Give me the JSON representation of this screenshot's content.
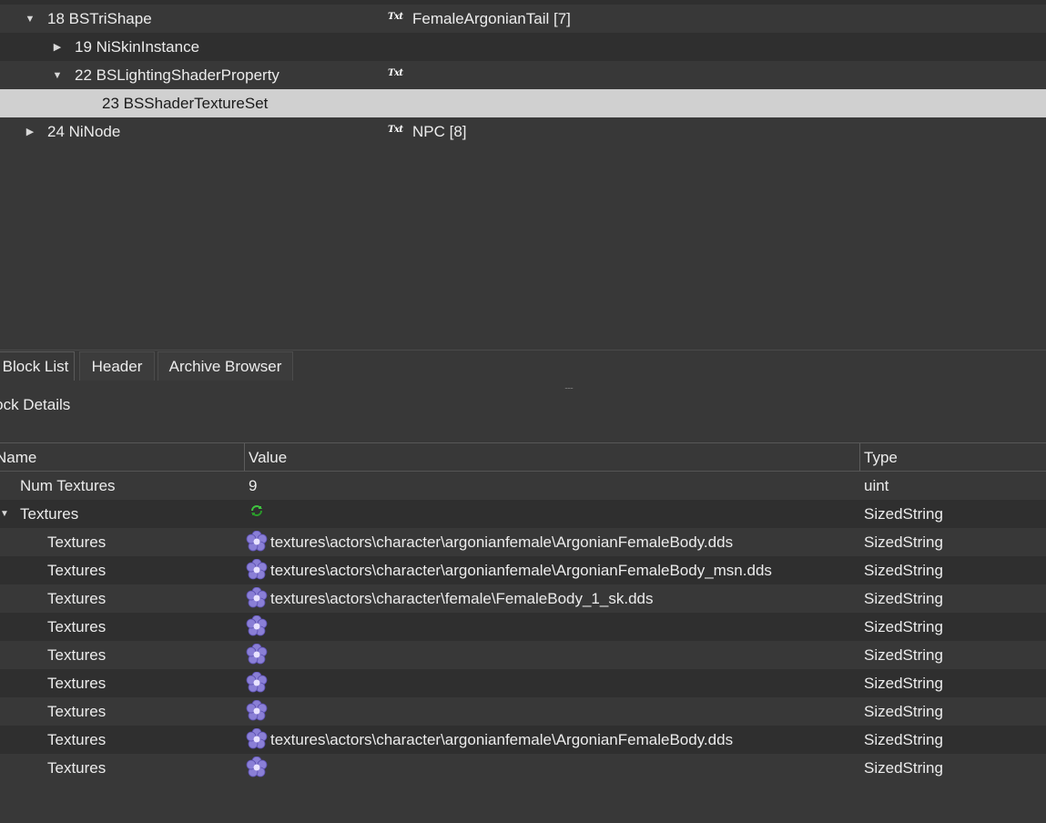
{
  "tree": {
    "rows": [
      {
        "id": "18",
        "label": "18 BSTriShape",
        "value": "FemaleArgonianTail [7]",
        "type_icon": "Txt",
        "expanded": true
      },
      {
        "id": "19",
        "label": "19 NiSkinInstance",
        "value": "",
        "type_icon": "",
        "expanded": false
      },
      {
        "id": "22",
        "label": "22 BSLightingShaderProperty",
        "value": "",
        "type_icon": "Txt",
        "expanded": true
      },
      {
        "id": "23",
        "label": "23 BSShaderTextureSet",
        "value": "",
        "type_icon": "",
        "selected": true
      },
      {
        "id": "24",
        "label": "24 NiNode",
        "value": "NPC [8]",
        "type_icon": "Txt",
        "expanded": false
      }
    ]
  },
  "tabs": [
    {
      "label": "Block List",
      "active": true
    },
    {
      "label": "Header",
      "active": false
    },
    {
      "label": "Archive Browser",
      "active": false
    }
  ],
  "details": {
    "title": "Block Details",
    "columns": {
      "name": "Name",
      "value": "Value",
      "type": "Type"
    },
    "rows": [
      {
        "name": "Num Textures",
        "value": "9",
        "type": "uint",
        "icon": ""
      },
      {
        "name": "Textures",
        "value": "",
        "type": "SizedString",
        "icon": "refresh-icon",
        "expanded": true
      },
      {
        "name": "Textures",
        "value": "textures\\actors\\character\\argonianfemale\\ArgonianFemaleBody.dds",
        "type": "SizedString",
        "icon": "flower-icon"
      },
      {
        "name": "Textures",
        "value": "textures\\actors\\character\\argonianfemale\\ArgonianFemaleBody_msn.dds",
        "type": "SizedString",
        "icon": "flower-icon"
      },
      {
        "name": "Textures",
        "value": "textures\\actors\\character\\female\\FemaleBody_1_sk.dds",
        "type": "SizedString",
        "icon": "flower-icon"
      },
      {
        "name": "Textures",
        "value": "",
        "type": "SizedString",
        "icon": "flower-icon"
      },
      {
        "name": "Textures",
        "value": "",
        "type": "SizedString",
        "icon": "flower-icon"
      },
      {
        "name": "Textures",
        "value": "",
        "type": "SizedString",
        "icon": "flower-icon"
      },
      {
        "name": "Textures",
        "value": "",
        "type": "SizedString",
        "icon": "flower-icon"
      },
      {
        "name": "Textures",
        "value": "textures\\actors\\character\\argonianfemale\\ArgonianFemaleBody.dds",
        "type": "SizedString",
        "icon": "flower-icon"
      },
      {
        "name": "Textures",
        "value": "",
        "type": "SizedString",
        "icon": "flower-icon"
      }
    ]
  },
  "colors": {
    "background": "#383838",
    "row_alt": "#2f2f2f",
    "selected_row": "#d0d0d0",
    "text": "#ececec",
    "flower_icon": "#8a7fd6"
  }
}
